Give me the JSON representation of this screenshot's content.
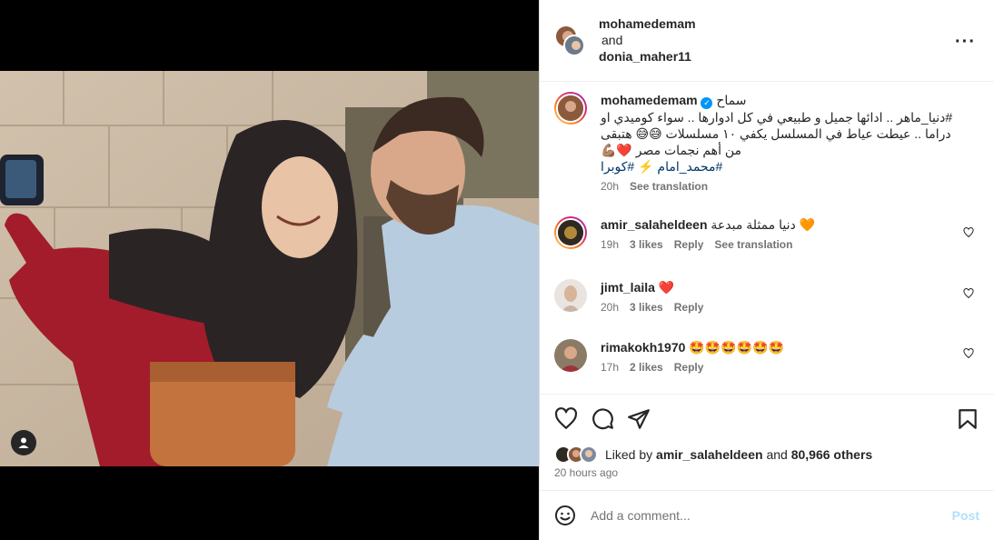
{
  "header": {
    "user1": "mohamedemam",
    "and_text": "and",
    "user2": "donia_maher11"
  },
  "caption": {
    "username": "mohamedemam",
    "first_line": "سماح",
    "line2": "#دنيا_ماهر .. ادائها جميل و طبيعي في كل ادوارها .. سواء كوميدي او",
    "line3": "دراما .. عيطت عياط في المسلسل يكفي ١٠ مسلسلات 😅😅 هتبقى",
    "line4": "من أهم نجمات مصر ❤️💪🏽",
    "line5": "#محمد_امام ⚡️ #كوبرا",
    "time": "20h",
    "translate": "See translation"
  },
  "comments": [
    {
      "username": "amir_salaheldeen",
      "text": "دنيا ممثلة مبدعة 🧡",
      "time": "19h",
      "likes": "3 likes",
      "reply": "Reply",
      "translate": "See translation"
    },
    {
      "username": "jimt_laila",
      "text": "❤️",
      "time": "20h",
      "likes": "3 likes",
      "reply": "Reply"
    },
    {
      "username": "rimakokh1970",
      "text": "🤩🤩🤩🤩🤩🤩",
      "time": "17h",
      "likes": "2 likes",
      "reply": "Reply"
    }
  ],
  "likes": {
    "prefix": "Liked by",
    "user": "amir_salaheldeen",
    "and": "and",
    "others": "80,966 others"
  },
  "posted_ago": "20 hours ago",
  "comment_input": {
    "placeholder": "Add a comment...",
    "post_label": "Post"
  },
  "colors": {
    "link": "#00376b",
    "muted": "#737373",
    "post_disabled": "#b2dffc",
    "verified": "#0095f6",
    "heart": "#ed4956"
  }
}
